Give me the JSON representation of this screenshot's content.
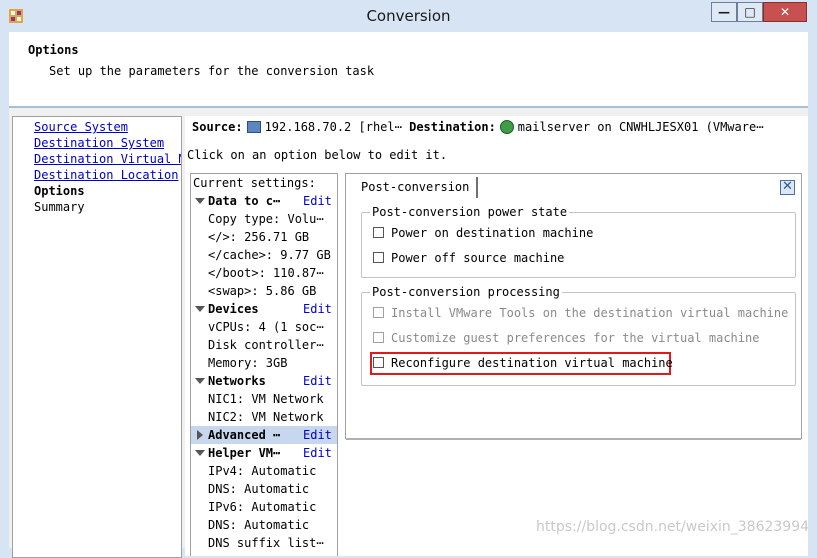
{
  "window": {
    "title": "Conversion",
    "minimize_glyph": "—",
    "maximize_glyph": "□",
    "close_glyph": "✕"
  },
  "header": {
    "title": "Options",
    "subtitle": "Set up the parameters for the conversion task"
  },
  "nav": {
    "items": [
      {
        "label": "Source System"
      },
      {
        "label": "Destination System"
      },
      {
        "label": "Destination Virtual M"
      },
      {
        "label": "Destination Location"
      },
      {
        "label": "Options"
      },
      {
        "label": "Summary"
      }
    ]
  },
  "main": {
    "source_label": "Source:",
    "source_value": "192.168.70.2 [rhel⋯",
    "destination_label": "Destination:",
    "destination_value": "mailserver on CNWHLJESX01 (VMware⋯",
    "instruction": "Click on an option below to edit it."
  },
  "settings": {
    "header": "Current settings:",
    "edit_label": "Edit",
    "sections": [
      {
        "title": "Data to c⋯",
        "items": [
          "Copy type: Volu⋯",
          "</>: 256.71 GB",
          "</cache>: 9.77 GB",
          "</boot>: 110.87⋯",
          "<swap>: 5.86 GB"
        ]
      },
      {
        "title": "Devices",
        "items": [
          "vCPUs: 4 (1 soc⋯",
          "Disk controller⋯",
          "Memory: 3GB"
        ]
      },
      {
        "title": "Networks",
        "items": [
          "NIC1: VM Network",
          "NIC2: VM Network"
        ]
      },
      {
        "title": "Advanced ⋯",
        "items": []
      },
      {
        "title": "Helper VM⋯",
        "items": [
          "IPv4: Automatic",
          "DNS: Automatic",
          "IPv6: Automatic",
          "DNS: Automatic",
          "DNS suffix list⋯"
        ]
      }
    ]
  },
  "post_conversion": {
    "tab_label": "Post-conversion",
    "power_group": {
      "legend": "Post-conversion power state",
      "options": [
        {
          "label": "Power on destination machine",
          "checked": false
        },
        {
          "label": "Power off source machine",
          "checked": false
        }
      ]
    },
    "processing_group": {
      "legend": "Post-conversion processing",
      "options": [
        {
          "label": "Install VMware Tools on the destination virtual machine",
          "checked": false,
          "enabled": false
        },
        {
          "label": "Customize guest preferences for the virtual machine",
          "checked": false,
          "enabled": false
        },
        {
          "label": "Reconfigure destination virtual machine",
          "checked": false,
          "enabled": true
        }
      ]
    }
  },
  "watermark": "https://blog.csdn.net/weixin_38623994"
}
